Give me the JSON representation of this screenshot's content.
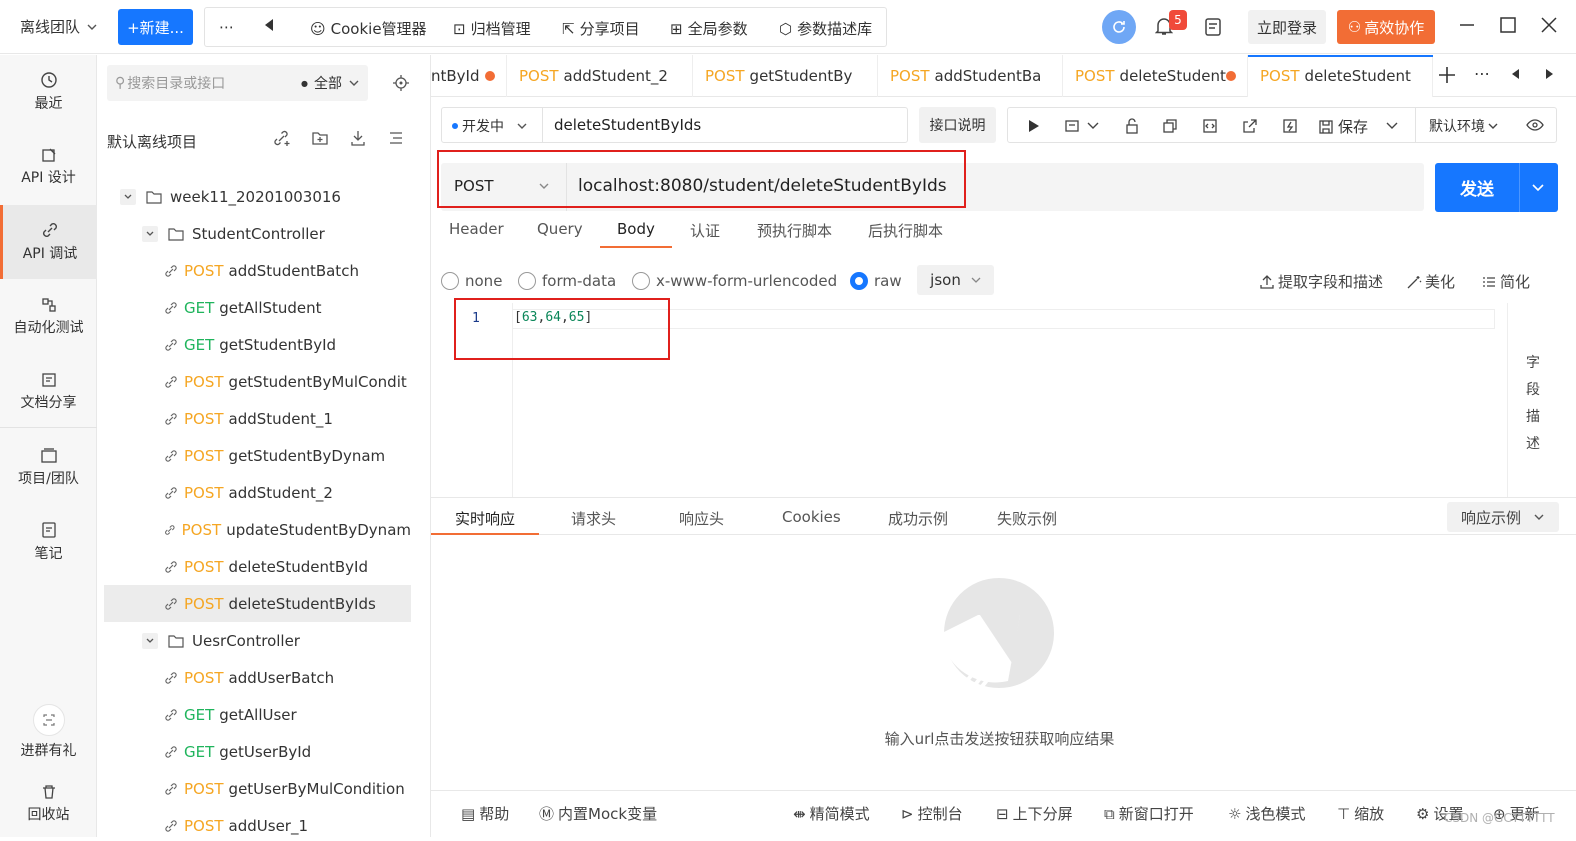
{
  "topbar": {
    "team": "离线团队",
    "new_btn": "+新建...",
    "tools": [
      "Cookie管理器",
      "归档管理",
      "分享项目",
      "全局参数",
      "参数描述库"
    ],
    "notification_count": "5",
    "login": "立即登录",
    "collab": "高效协作"
  },
  "rail": {
    "items": [
      "最近",
      "API 设计",
      "API 调试",
      "自动化测试",
      "文档分享",
      "项目/团队",
      "笔记"
    ],
    "bottom": [
      "进群有礼",
      "回收站"
    ]
  },
  "tree": {
    "search_placeholder": "搜索目录或接口",
    "scope": "全部",
    "project": "默认离线项目",
    "folder": "week11_20201003016",
    "controller1": "StudentController",
    "student_apis": [
      {
        "method": "POST",
        "name": "addStudentBatch"
      },
      {
        "method": "GET",
        "name": "getAllStudent"
      },
      {
        "method": "GET",
        "name": "getStudentById"
      },
      {
        "method": "POST",
        "name": "getStudentByMulCondit"
      },
      {
        "method": "POST",
        "name": "addStudent_1"
      },
      {
        "method": "POST",
        "name": "getStudentByDynam"
      },
      {
        "method": "POST",
        "name": "addStudent_2"
      },
      {
        "method": "POST",
        "name": "updateStudentByDynam"
      },
      {
        "method": "POST",
        "name": "deleteStudentById"
      },
      {
        "method": "POST",
        "name": "deleteStudentByIds"
      }
    ],
    "controller2": "UesrController",
    "user_apis": [
      {
        "method": "POST",
        "name": "addUserBatch"
      },
      {
        "method": "GET",
        "name": "getAllUser"
      },
      {
        "method": "GET",
        "name": "getUserById"
      },
      {
        "method": "POST",
        "name": "getUserByMulCondition"
      },
      {
        "method": "POST",
        "name": "addUser_1"
      }
    ]
  },
  "tabs": [
    {
      "method": "",
      "name": "ntById"
    },
    {
      "method": "POST",
      "name": "addStudent_2"
    },
    {
      "method": "POST",
      "name": "getStudentBy"
    },
    {
      "method": "POST",
      "name": "addStudentBa"
    },
    {
      "method": "POST",
      "name": "deleteStudent"
    },
    {
      "method": "POST",
      "name": "deleteStudent"
    }
  ],
  "request": {
    "status": "开发中",
    "name": "deleteStudentByIds",
    "doc_btn": "接口说明",
    "save": "保存",
    "env": "默认环境",
    "method": "POST",
    "url": "localhost:8080/student/deleteStudentByIds",
    "send": "发送"
  },
  "req_tabs": [
    "Header",
    "Query",
    "Body",
    "认证",
    "预执行脚本",
    "后执行脚本"
  ],
  "body_modes": [
    "none",
    "form-data",
    "x-www-form-urlencoded",
    "raw"
  ],
  "body_format": "json",
  "body_tools": [
    "提取字段和描述",
    "美化",
    "简化"
  ],
  "editor": {
    "line": "1",
    "open": "[",
    "nums": [
      "63",
      "64",
      "65"
    ],
    "close": "]"
  },
  "field_desc": [
    "字",
    "段",
    "描",
    "述"
  ],
  "resp_tabs": [
    "实时响应",
    "请求头",
    "响应头",
    "Cookies",
    "成功示例",
    "失败示例"
  ],
  "resp_example": "响应示例",
  "empty_hint": "输入url点击发送按钮获取响应结果",
  "footer": [
    "帮助",
    "内置Mock变量",
    "精简模式",
    "控制台",
    "上下分屏",
    "新窗口打开",
    "浅色模式",
    "缩放",
    "设置",
    "更新"
  ],
  "watermark": "CSDN @GCTTTTTT"
}
